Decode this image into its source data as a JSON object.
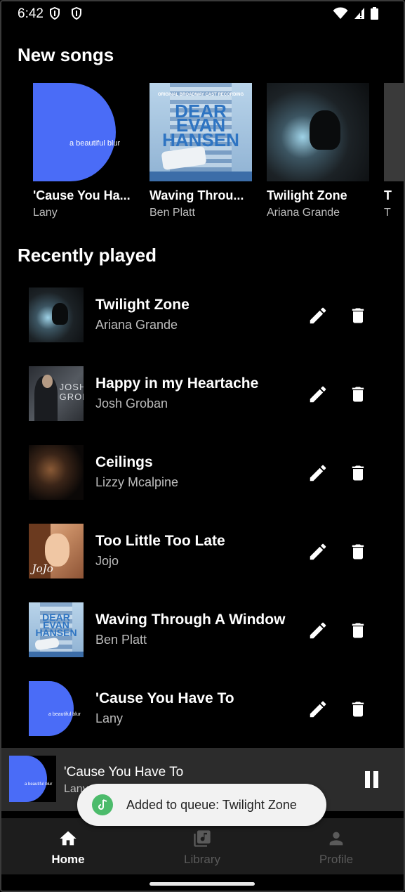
{
  "status_bar": {
    "time": "6:42",
    "left_icons": [
      "shield-icon",
      "shield-icon"
    ],
    "right_icons": [
      "wifi-icon",
      "cell-signal-icon",
      "battery-icon"
    ]
  },
  "new_songs": {
    "title": "New songs",
    "items": [
      {
        "title": "'Cause You Ha...",
        "artist": "Lany",
        "art": "a-beautiful-blur",
        "art_text": "a beautiful blur"
      },
      {
        "title": "Waving Throu...",
        "artist": "Ben Platt",
        "art": "dear-evan-hansen",
        "art_text": "DEAR EVAN HANSEN",
        "art_subtext": "ORIGINAL BROADWAY CAST RECORDING"
      },
      {
        "title": "Twilight Zone",
        "artist": "Ariana Grande",
        "art": "twilight-zone"
      },
      {
        "title": "T",
        "artist": "T",
        "art": "partial"
      }
    ]
  },
  "recently_played": {
    "title": "Recently played",
    "items": [
      {
        "title": "Twilight Zone",
        "artist": "Ariana Grande",
        "art": "twilight-zone"
      },
      {
        "title": "Happy in my Heartache",
        "artist": "Josh Groban",
        "art": "josh-groban",
        "art_text": "JOSH GROBAN"
      },
      {
        "title": "Ceilings",
        "artist": "Lizzy Mcalpine",
        "art": "ceilings"
      },
      {
        "title": "Too Little Too Late",
        "artist": "Jojo",
        "art": "jojo",
        "art_text": "JoJo"
      },
      {
        "title": "Waving Through A Window",
        "artist": "Ben Platt",
        "art": "dear-evan-hansen",
        "art_text": "DEAR EVAN HANSEN"
      },
      {
        "title": "'Cause You Have To",
        "artist": "Lany",
        "art": "a-beautiful-blur",
        "art_text": "a beautiful blur"
      }
    ],
    "edit_icon": "pencil-icon",
    "delete_icon": "trash-icon"
  },
  "mini_player": {
    "title": "'Cause You Have To",
    "artist": "Lany",
    "art_text": "a beautiful blur",
    "control_icon": "pause-icon"
  },
  "snackbar": {
    "text": "Added to queue: Twilight Zone",
    "icon": "app-icon"
  },
  "bottom_nav": {
    "items": [
      {
        "label": "Home",
        "icon": "home-icon",
        "active": true
      },
      {
        "label": "Library",
        "icon": "library-music-icon",
        "active": false
      },
      {
        "label": "Profile",
        "icon": "person-icon",
        "active": false
      }
    ]
  },
  "colors": {
    "background": "#000000",
    "accent_blue": "#4a6cf7",
    "mini_player_bg": "#2c2c2c",
    "nav_bg": "#1d1d1d",
    "snackbar_bg": "#f2f2f2",
    "snackbar_icon": "#4cbb6b"
  }
}
